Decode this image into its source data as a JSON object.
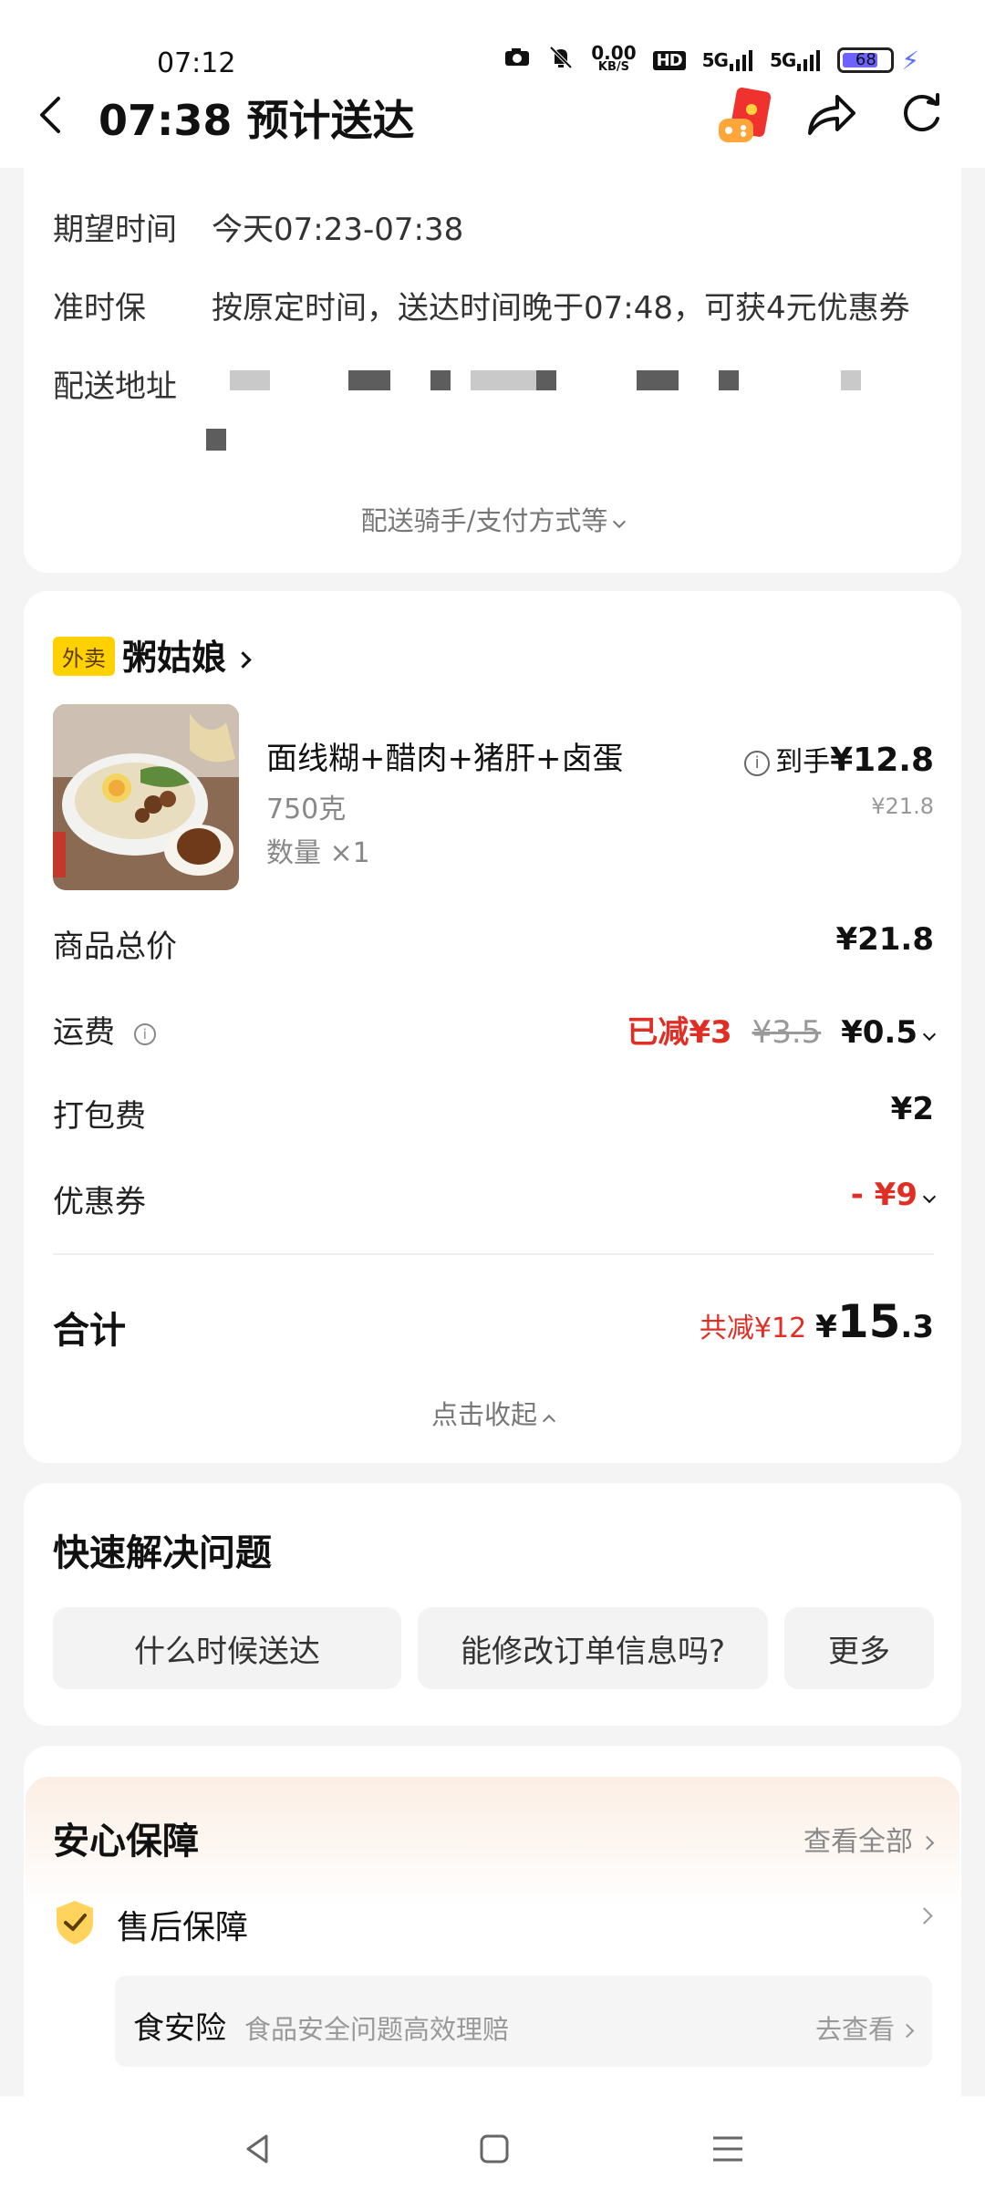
{
  "status_bar": {
    "time": "07:12",
    "speed": "0.00",
    "speed_unit": "KB/S",
    "hd": "HD",
    "net1": "5G",
    "net2": "5G",
    "battery": "68"
  },
  "header": {
    "title": "07:38 预计送达"
  },
  "delivery": {
    "expected_label": "期望时间",
    "expected_value": "今天07:23-07:38",
    "ontime_label": "准时保",
    "ontime_value": "按原定时间，送达时间晚于07:48，可获4元优惠券",
    "address_label": "配送地址",
    "more_link": "配送骑手/支付方式等"
  },
  "order": {
    "tag": "外卖",
    "store": "粥姑娘",
    "item": {
      "name": "面线糊+醋肉+猪肝+卤蛋",
      "weight": "750克",
      "qty": "数量 ×1",
      "final_prefix": "到手",
      "final_price": "¥12.8",
      "orig_price": "¥21.8"
    },
    "rows": {
      "goods_label": "商品总价",
      "goods_value": "¥21.8",
      "ship_label": "运费",
      "ship_reduced": "已减¥3",
      "ship_orig": "¥3.5",
      "ship_value": "¥0.5",
      "pack_label": "打包费",
      "pack_value": "¥2",
      "coupon_label": "优惠券",
      "coupon_value": "- ¥9"
    },
    "total_label": "合计",
    "total_saved": "共减¥12",
    "total_currency": "¥",
    "total_int": "15",
    "total_dec": ".3",
    "collapse": "点击收起"
  },
  "quick": {
    "title": "快速解决问题",
    "buttons": [
      "什么时候送达",
      "能修改订单信息吗?",
      "更多"
    ]
  },
  "guarantee": {
    "title": "安心保障",
    "view_all": "查看全部",
    "after_sale": "售后保障",
    "insurance_name": "食安险",
    "insurance_desc": "食品安全问题高效理赔",
    "insurance_go": "去查看"
  },
  "colors": {
    "accent_red": "#e02e24",
    "tag_yellow": "#ffd100",
    "background": "#f4f4f4"
  }
}
